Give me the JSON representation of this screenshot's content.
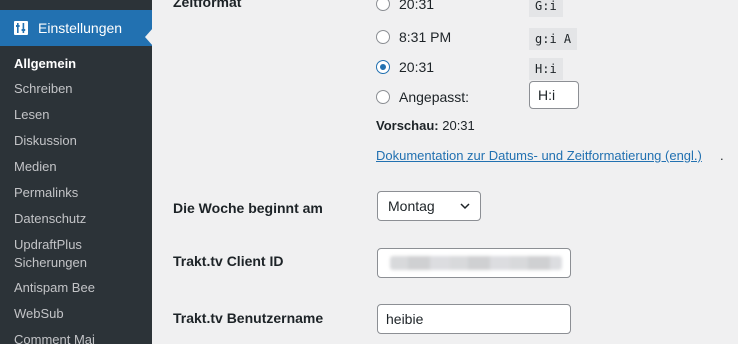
{
  "sidebar": {
    "active_menu": {
      "label": "Einstellungen",
      "icon": "settings-icon"
    },
    "items": [
      {
        "label": "Allgemein",
        "current": true
      },
      {
        "label": "Schreiben"
      },
      {
        "label": "Lesen"
      },
      {
        "label": "Diskussion"
      },
      {
        "label": "Medien"
      },
      {
        "label": "Permalinks"
      },
      {
        "label": "Datenschutz"
      },
      {
        "label": "UpdraftPlus\nSicherungen"
      },
      {
        "label": "Antispam Bee"
      },
      {
        "label": "WebSub"
      },
      {
        "label": "Comment Mai"
      }
    ]
  },
  "time_format": {
    "label": "Zeitformat",
    "options": [
      {
        "text": "20:31",
        "code": "G:i",
        "checked": false
      },
      {
        "text": "8:31 PM",
        "code": "g:i A",
        "checked": false
      },
      {
        "text": "20:31",
        "code": "H:i",
        "checked": true
      },
      {
        "text": "Angepasst:",
        "custom_value": "H:i",
        "checked": false
      }
    ],
    "preview_label": "Vorschau:",
    "preview_value": "20:31",
    "doc_link": "Dokumentation zur Datums- und Zeitformatierung (engl.)",
    "doc_suffix": "."
  },
  "week_start": {
    "label": "Die Woche beginnt am",
    "selected": "Montag"
  },
  "trakt_client_id": {
    "label": "Trakt.tv Client ID",
    "value": ""
  },
  "trakt_username": {
    "label": "Trakt.tv Benutzername",
    "value": "heibie"
  },
  "colors": {
    "sidebar_bg": "#2c3338",
    "accent": "#2271b1",
    "page_bg": "#f0f0f1"
  }
}
